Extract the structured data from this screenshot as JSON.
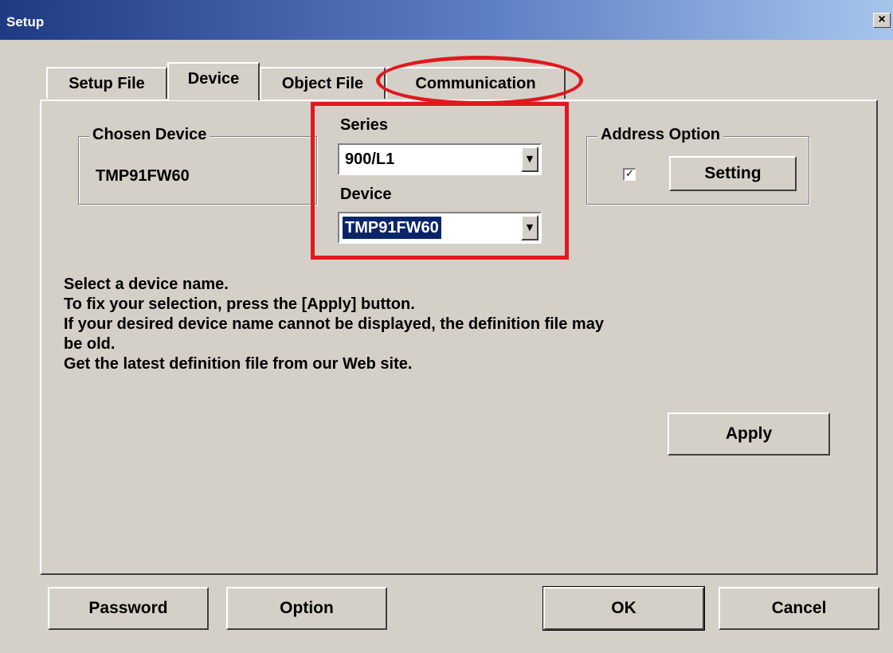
{
  "window": {
    "title": "Setup",
    "close_glyph": "×"
  },
  "tabs": [
    {
      "label": "Setup File",
      "active": false
    },
    {
      "label": "Device",
      "active": true
    },
    {
      "label": "Object File",
      "active": false
    },
    {
      "label": "Communication",
      "active": false
    }
  ],
  "chosen_device": {
    "group_label": "Chosen Device",
    "value": "TMP91FW60"
  },
  "series": {
    "label": "Series",
    "value": "900/L1"
  },
  "device": {
    "label": "Device",
    "value": "TMP91FW60"
  },
  "address_option": {
    "group_label": "Address Option",
    "checked": true,
    "checkbox_glyph": "✓",
    "setting_label": "Setting"
  },
  "message_lines": [
    "Select a device name.",
    "To fix your selection, press the [Apply] button.",
    "If your desired device name cannot be displayed, the definition file may",
    "be old.",
    "Get the latest definition file from our Web site."
  ],
  "apply_label": "Apply",
  "footer": {
    "password_label": "Password",
    "option_label": "Option",
    "ok_label": "OK",
    "cancel_label": "Cancel"
  },
  "icons": {
    "dropdown_arrow": "▼"
  },
  "annotation_color": "#e0191f"
}
